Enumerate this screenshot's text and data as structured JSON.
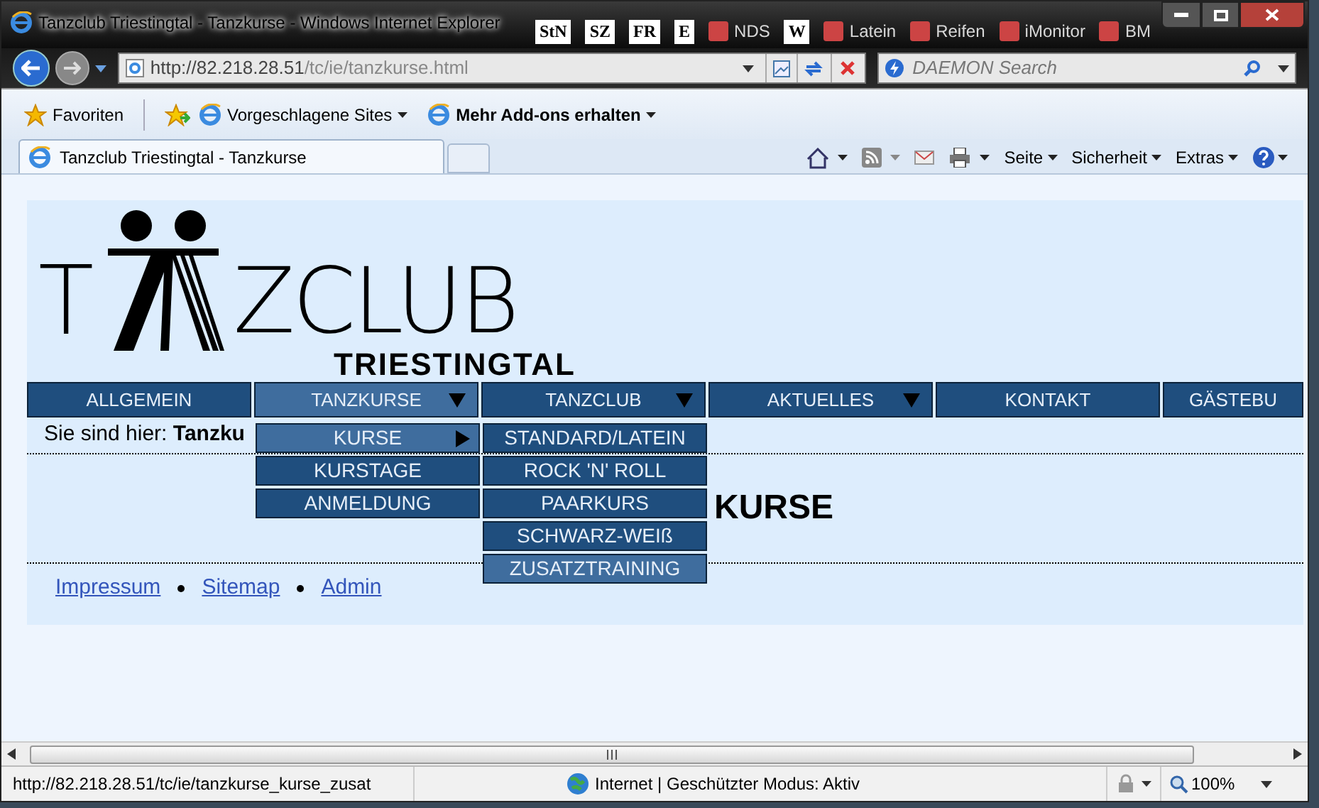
{
  "window": {
    "title": "Tanzclub Triestingtal - Tanzkurse - Windows Internet Explorer"
  },
  "links_bar": [
    {
      "label": "StN",
      "kind": "badge"
    },
    {
      "label": "SZ",
      "kind": "badge"
    },
    {
      "label": "FR",
      "kind": "badge"
    },
    {
      "label": "E",
      "kind": "badge"
    },
    {
      "label": "NDS",
      "kind": "text"
    },
    {
      "label": "W",
      "kind": "badge"
    },
    {
      "label": "Latein",
      "kind": "text"
    },
    {
      "label": "Reifen",
      "kind": "text"
    },
    {
      "label": "iMonitor",
      "kind": "text"
    },
    {
      "label": "BM",
      "kind": "text"
    }
  ],
  "address_bar": {
    "url_host": "http://82.218.28.51",
    "url_path": "/tc/ie/tanzkurse.html"
  },
  "search": {
    "placeholder": "DAEMON Search"
  },
  "favorites_bar": [
    {
      "label": "Favoriten",
      "dropdown": false,
      "bold": false
    },
    {
      "label": "Vorgeschlagene Sites",
      "dropdown": true,
      "bold": false
    },
    {
      "label": "Mehr Add-ons erhalten",
      "dropdown": true,
      "bold": true
    }
  ],
  "tabs": [
    {
      "label": "Tanzclub Triestingtal - Tanzkurse",
      "selected": true
    }
  ],
  "command_bar": [
    "Seite",
    "Sicherheit",
    "Extras"
  ],
  "page": {
    "logo": {
      "start": "T",
      "end": "ZCLUB",
      "subtitle": "TRIESTINGTAL"
    },
    "nav": [
      {
        "label": "ALLGEMEIN",
        "selected": false,
        "dropdown": false
      },
      {
        "label": "TANZKURSE",
        "selected": true,
        "dropdown": true
      },
      {
        "label": "TANZCLUB",
        "selected": false,
        "dropdown": true
      },
      {
        "label": "AKTUELLES",
        "selected": false,
        "dropdown": true
      },
      {
        "label": "KONTAKT",
        "selected": false,
        "dropdown": false
      },
      {
        "label": "GÄSTEBU",
        "selected": false,
        "dropdown": false
      }
    ],
    "breadcrumb": {
      "prefix": "Sie sind hier:",
      "current": "Tanzku"
    },
    "heading": "KURSE",
    "menu": [
      {
        "label": "KURSE",
        "selected": true,
        "submenu": true
      },
      {
        "label": "KURSTAGE",
        "selected": false,
        "submenu": false
      },
      {
        "label": "ANMELDUNG",
        "selected": false,
        "submenu": false
      }
    ],
    "submenu": [
      {
        "label": "STANDARD/LATEIN",
        "selected": false
      },
      {
        "label": "ROCK 'N' ROLL",
        "selected": false
      },
      {
        "label": "PAARKURS",
        "selected": false
      },
      {
        "label": "SCHWARZ-WEIß",
        "selected": false
      },
      {
        "label": "ZUSATZTRAINING",
        "selected": true
      }
    ],
    "footer_links": [
      "Impressum",
      "Sitemap",
      "Admin"
    ]
  },
  "status_bar": {
    "url": "http://82.218.28.51/tc/ie/tanzkurse_kurse_zusat",
    "zone": "Internet | Geschützter Modus: Aktiv",
    "zoom": "100%"
  }
}
